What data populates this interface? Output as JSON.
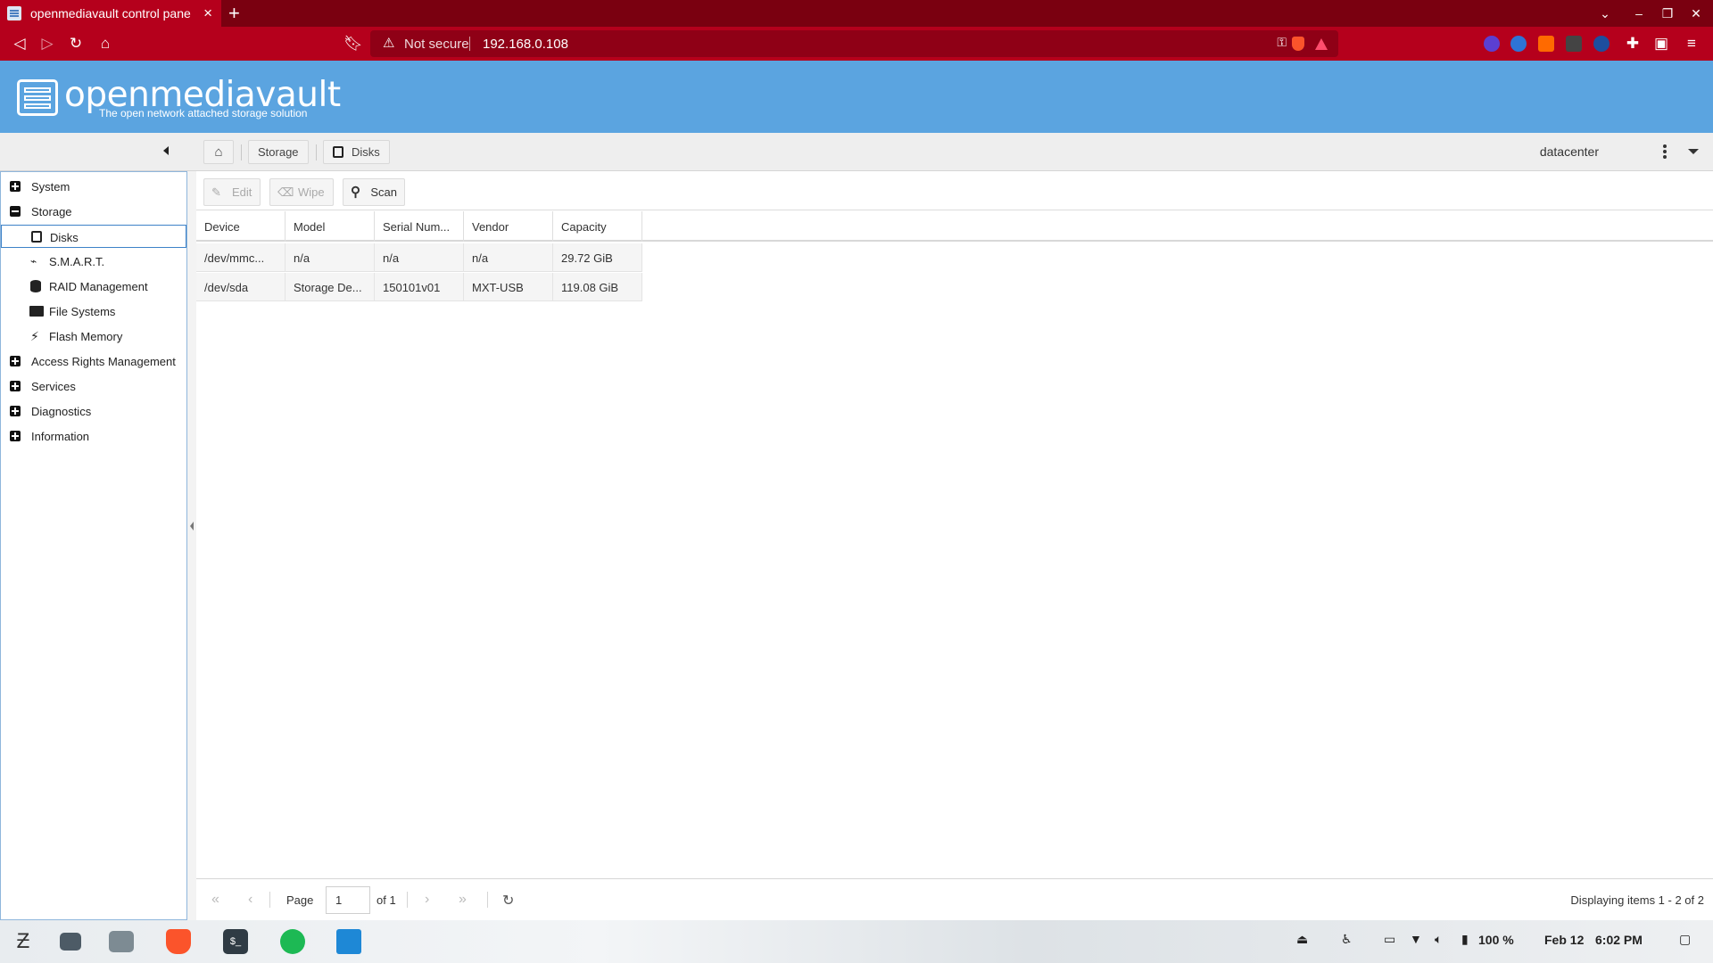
{
  "browser": {
    "tab_title": "openmediavault control pane",
    "security_label": "Not secure",
    "url": "192.168.0.108",
    "shields_count": "1",
    "rewards_count": "1",
    "ext_badge": "3",
    "theme_color": "#b5001c"
  },
  "header": {
    "brand": "openmediavault",
    "tagline": "The open network attached storage solution",
    "color": "#5ba4e0"
  },
  "breadcrumb": {
    "storage": "Storage",
    "disks": "Disks"
  },
  "user": {
    "name": "datacenter"
  },
  "sidebar": {
    "items": [
      {
        "label": "System",
        "icon": "plus-icon"
      },
      {
        "label": "Storage",
        "icon": "minus-icon"
      },
      {
        "label": "Disks",
        "icon": "disk-icon"
      },
      {
        "label": "S.M.A.R.T.",
        "icon": "pulse-icon"
      },
      {
        "label": "RAID Management",
        "icon": "database-icon"
      },
      {
        "label": "File Systems",
        "icon": "folders-icon"
      },
      {
        "label": "Flash Memory",
        "icon": "bolt-icon"
      },
      {
        "label": "Access Rights Management",
        "icon": "plus-icon"
      },
      {
        "label": "Services",
        "icon": "plus-icon"
      },
      {
        "label": "Diagnostics",
        "icon": "plus-icon"
      },
      {
        "label": "Information",
        "icon": "plus-icon"
      }
    ]
  },
  "actions": {
    "edit": "Edit",
    "wipe": "Wipe",
    "scan": "Scan"
  },
  "table": {
    "columns": [
      "Device",
      "Model",
      "Serial Num...",
      "Vendor",
      "Capacity"
    ],
    "rows": [
      [
        "/dev/mmc...",
        "n/a",
        "n/a",
        "n/a",
        "29.72 GiB"
      ],
      [
        "/dev/sda",
        "Storage De...",
        "150101v01",
        "MXT-USB",
        "119.08 GiB"
      ]
    ]
  },
  "pager": {
    "page_label": "Page",
    "page_value": "1",
    "of_label": "of 1",
    "display_text": "Displaying items 1 - 2 of 2"
  },
  "taskbar": {
    "battery": "100 %",
    "date": "Feb 12",
    "time": "6:02 PM"
  }
}
